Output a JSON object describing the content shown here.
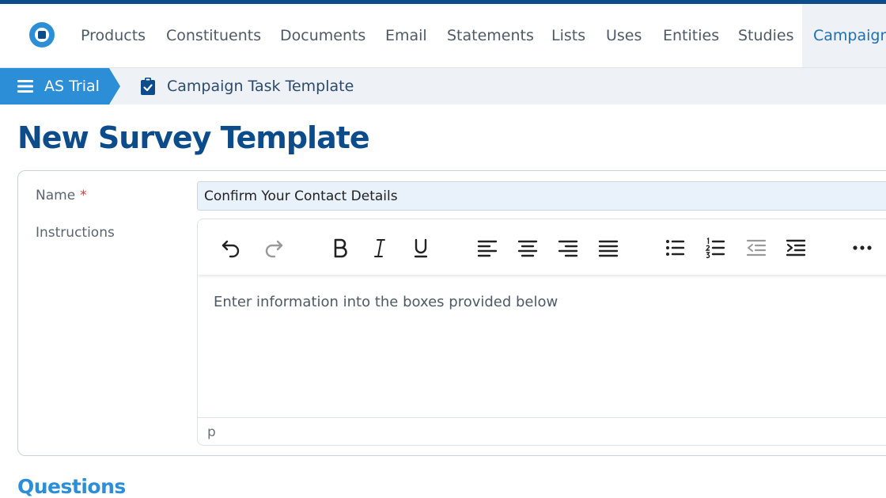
{
  "nav": {
    "items": [
      "Products",
      "Constituents",
      "Documents",
      "Email",
      "Statements",
      "Lists",
      "Uses",
      "Entities",
      "Studies",
      "Campaign"
    ],
    "active_index": 9
  },
  "breadcrumb": {
    "home": "AS Trial",
    "current": "Campaign Task Template"
  },
  "page": {
    "title": "New Survey Template"
  },
  "form": {
    "name_label": "Name",
    "name_required": "*",
    "name_value": "Confirm Your Contact Details",
    "instructions_label": "Instructions",
    "editor_content": "Enter information into the boxes provided below",
    "editor_status": "p"
  },
  "section": {
    "questions": "Questions"
  },
  "colors": {
    "brand": "#0d4c8b",
    "accent": "#2d8ed8",
    "required": "#dd3333"
  },
  "toolbar_icons": [
    "undo-icon",
    "redo-icon",
    "bold-icon",
    "italic-icon",
    "underline-icon",
    "align-left-icon",
    "align-center-icon",
    "align-right-icon",
    "align-justify-icon",
    "bullet-list-icon",
    "numbered-list-icon",
    "outdent-icon",
    "indent-icon",
    "more-icon"
  ]
}
